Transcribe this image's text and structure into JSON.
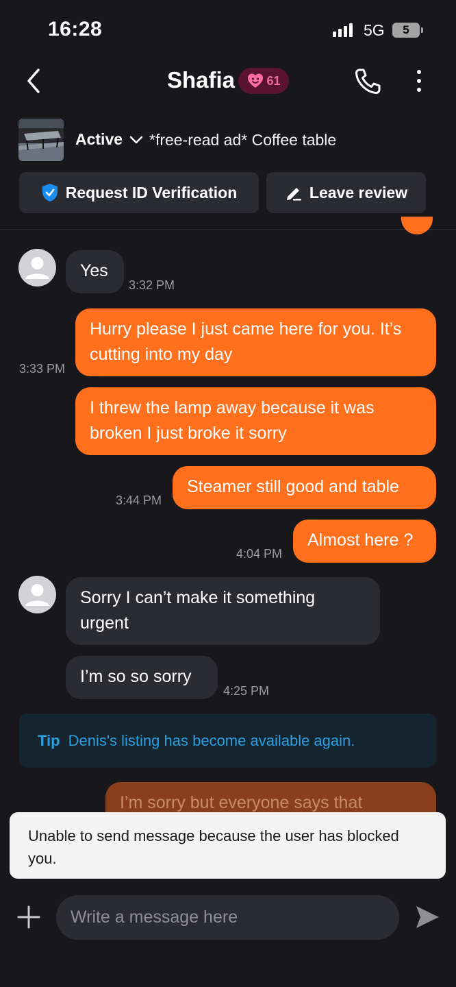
{
  "status_bar": {
    "time": "16:28",
    "network": "5G",
    "battery": "5"
  },
  "header": {
    "name": "Shafia",
    "karma": "61"
  },
  "listing": {
    "status": "Active",
    "title": "*free-read ad* Coffee table"
  },
  "actions": {
    "verify_label": "Request ID Verification",
    "review_label": "Leave review"
  },
  "messages": [
    {
      "from": "them",
      "text": "Yes",
      "time": "3:32 PM"
    },
    {
      "from": "me",
      "text": "Hurry please I just came here for you. It’s cutting into my day",
      "time": "3:33 PM"
    },
    {
      "from": "me",
      "text": "I threw the lamp away because it was broken I just broke it sorry",
      "time": ""
    },
    {
      "from": "me",
      "text": "Steamer still good and table",
      "time": "3:44 PM"
    },
    {
      "from": "me",
      "text": "Almost here ?",
      "time": "4:04 PM"
    },
    {
      "from": "them",
      "text": "Sorry I can’t make it something urgent",
      "time": ""
    },
    {
      "from": "them",
      "text": "I’m so so sorry",
      "time": "4:25 PM"
    },
    {
      "from": "me",
      "text": "I’m sorry but everyone says that",
      "time": ""
    }
  ],
  "tip": {
    "label": "Tip",
    "text": "Denis's listing has become available again."
  },
  "toast": {
    "text": "Unable to send message because the user has blocked you."
  },
  "composer": {
    "placeholder": "Write a message here"
  },
  "colors": {
    "accent": "#ff6f1c",
    "background": "#18181c",
    "bubble_in": "#2b2c31",
    "tip": "#2b9fe0"
  }
}
